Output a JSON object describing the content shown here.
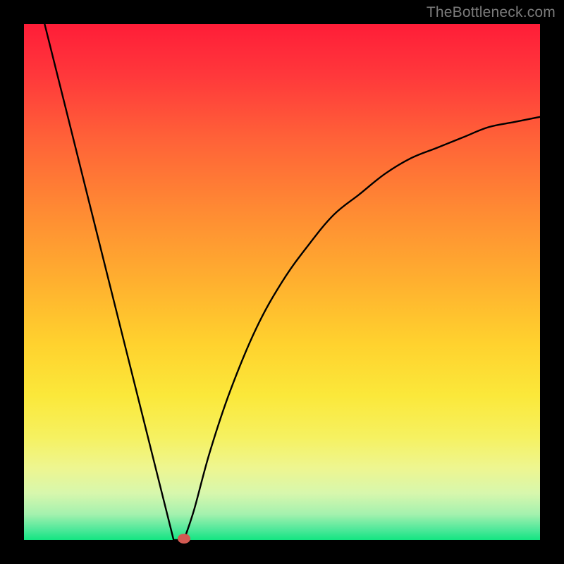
{
  "watermark": "TheBottleneck.com",
  "colors": {
    "frame": "#000000",
    "curve": "#000000",
    "marker": "#d25a52",
    "gradient_top": "#ff1d38",
    "gradient_bottom": "#13e581"
  },
  "chart_data": {
    "type": "line",
    "title": "",
    "xlabel": "",
    "ylabel": "",
    "xlim": [
      0,
      100
    ],
    "ylim": [
      0,
      100
    ],
    "grid": false,
    "legend": false,
    "series": [
      {
        "name": "bottleneck-curve",
        "x": [
          4,
          8,
          12,
          16,
          20,
          24,
          28,
          29,
          30,
          31,
          33,
          36,
          40,
          45,
          50,
          55,
          60,
          65,
          70,
          75,
          80,
          85,
          90,
          95,
          100
        ],
        "y": [
          100,
          84,
          68,
          52,
          36,
          20,
          4,
          0,
          0,
          0,
          6,
          17,
          29,
          41,
          50,
          57,
          63,
          67,
          71,
          74,
          76,
          78,
          80,
          81,
          82
        ]
      }
    ],
    "annotations": [
      {
        "type": "marker",
        "x": 31,
        "y": 0,
        "label": "optimal-point"
      }
    ]
  }
}
